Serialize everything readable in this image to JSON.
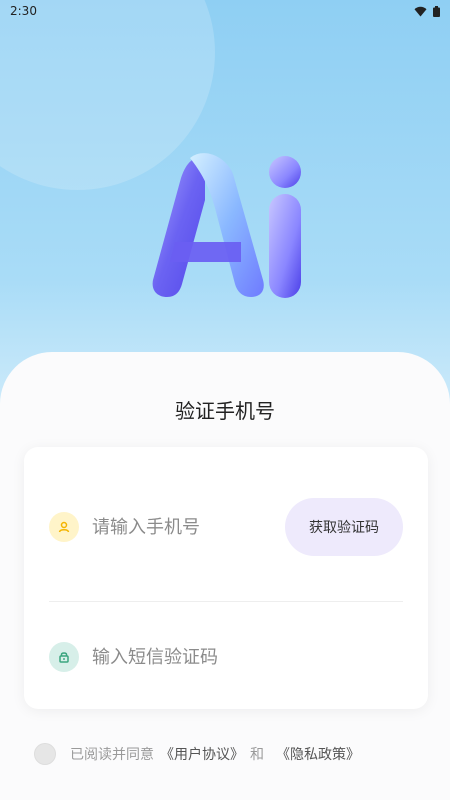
{
  "status_bar": {
    "time": "2:30",
    "wifi_icon": "wifi-icon",
    "battery_icon": "battery-icon"
  },
  "logo": {
    "text": "Ai"
  },
  "login": {
    "title": "验证手机号"
  },
  "phone_field": {
    "placeholder": "请输入手机号",
    "icon": "person-icon"
  },
  "code_button": {
    "label": "获取验证码"
  },
  "code_field": {
    "placeholder": "输入短信验证码",
    "icon": "lock-icon"
  },
  "agreement": {
    "text": "已阅读并同意",
    "user_agreement": "《用户协议》",
    "and": "和",
    "privacy_policy": "《隐私政策》"
  },
  "colors": {
    "sky": "#8fcff3",
    "button_bg": "#eeeafc",
    "phone_icon_bg": "#fff4c9",
    "lock_icon_bg": "#d7efe9"
  }
}
